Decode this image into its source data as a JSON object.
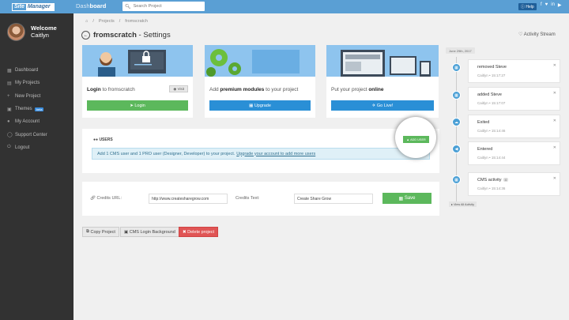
{
  "topbar": {
    "logo_part1": "Site",
    "logo_part2": "Manager",
    "home_label": "Dash",
    "home_label_bold": "board",
    "search_placeholder": "Search Project",
    "help_label": "Help",
    "social": [
      "f",
      "♥",
      "in",
      "▶"
    ]
  },
  "sidebar": {
    "welcome": "Welcome",
    "user_name": "Caitlyn",
    "items": [
      {
        "label": "Dashboard",
        "icon": "dashboard-icon"
      },
      {
        "label": "My Projects",
        "icon": "folder-icon"
      },
      {
        "label": "New Project",
        "icon": "plus-icon"
      },
      {
        "label": "Themes",
        "icon": "picture-icon",
        "badge": "beta"
      },
      {
        "label": "My Account",
        "icon": "user-icon"
      },
      {
        "label": "Support Center",
        "icon": "lifebuoy-icon"
      },
      {
        "label": "Logout",
        "icon": "power-icon"
      }
    ]
  },
  "breadcrumb": [
    "Projects",
    "fromscratch"
  ],
  "page": {
    "name": "fromscratch",
    "suffix": " - Settings",
    "activity_link": "Activity Stream"
  },
  "cards": [
    {
      "text_bold": "Login",
      "text_rest": " to fromscratch",
      "button": "Login",
      "visit": "Visit",
      "color": "#5cb85c"
    },
    {
      "text_pre": "Add ",
      "text_bold": "premium modules",
      "text_rest": " to your project",
      "button": "Upgrade",
      "color": "#2a8fd6"
    },
    {
      "text_pre": "Put your project ",
      "text_bold": "online",
      "button": "Go Live!",
      "color": "#2a8fd6"
    }
  ],
  "users": {
    "heading": "USERS",
    "add_button": "ADD USER",
    "info": "Add 1 CMS user and 1 PRO user (Designer, Developer) to your project.",
    "info_link": "Upgrade your account to add more users"
  },
  "credits": {
    "url_label": "Credits URL:",
    "url_value": "http://www.createsharegrow.com",
    "text_label": "Credits Text:",
    "text_value": "Create Share Grow",
    "save": "Save"
  },
  "bottom_buttons": [
    "Copy Project",
    "CMS Login Background",
    "Delete project"
  ],
  "activity": {
    "date": "June 29th, 2017",
    "items": [
      {
        "title": "removed Steve",
        "user": "Caitlyn",
        "time": "15:17:27"
      },
      {
        "title": "added Steve",
        "user": "Caitlyn",
        "time": "15:17:07"
      },
      {
        "title": "Exited",
        "user": "Caitlyn",
        "time": "15:14:46"
      },
      {
        "title": "Entered",
        "user": "Caitlyn",
        "time": "15:14:44"
      },
      {
        "title": "CMS activity",
        "count": "4",
        "user": "Caitlyn",
        "time": "15:14:36"
      }
    ],
    "view_all": "View All Activity"
  }
}
